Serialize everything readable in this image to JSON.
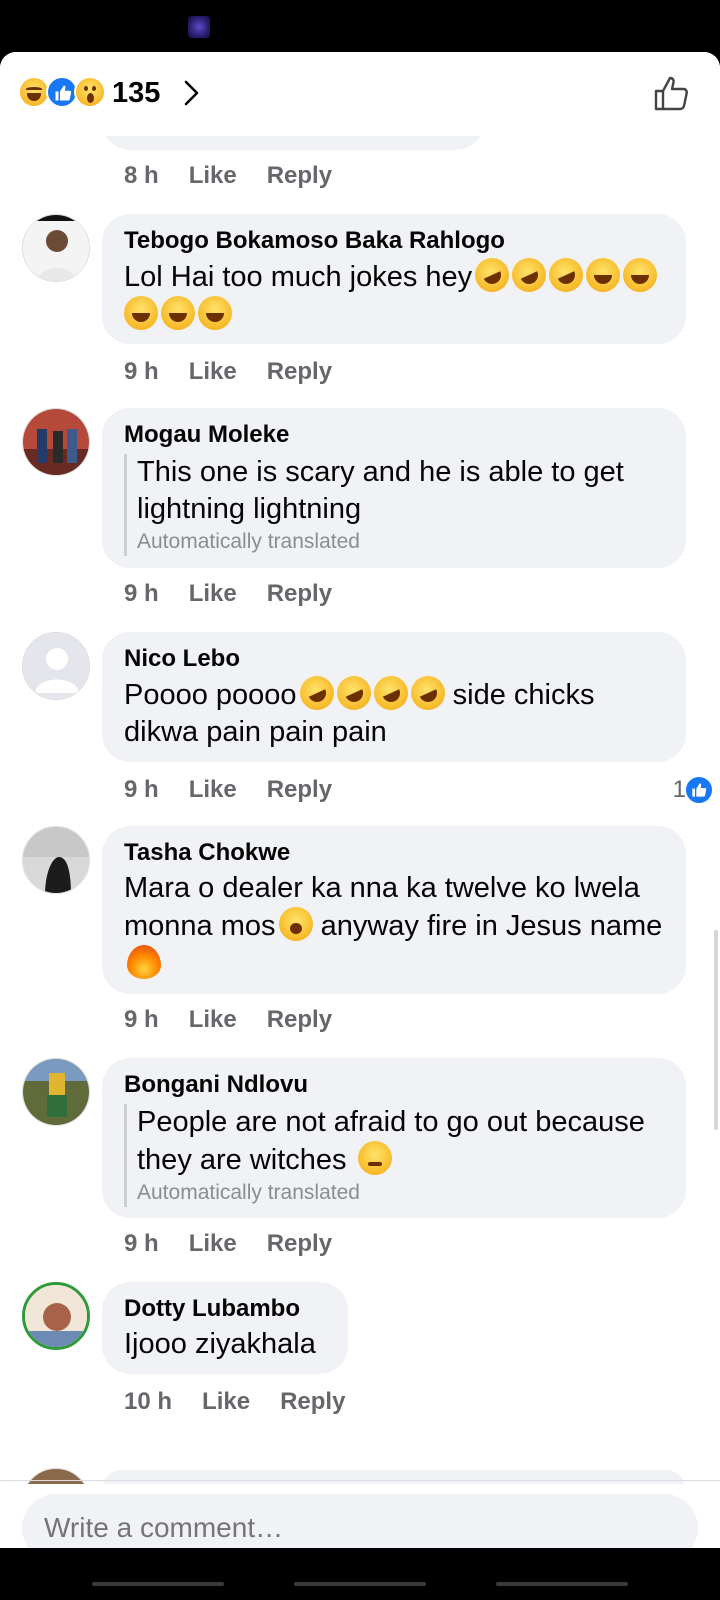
{
  "header": {
    "reaction_count": "135",
    "reaction_icons": [
      "haha-reaction-icon",
      "like-reaction-icon",
      "wow-reaction-icon"
    ],
    "actions": [
      "chevron-right-icon",
      "thumbs-up-icon"
    ]
  },
  "partial_comment": {
    "time": "8 h",
    "like_label": "Like",
    "reply_label": "Reply"
  },
  "comments": [
    {
      "author": "Tebogo Bokamoso Baka Rahlogo",
      "text": "Lol Hai too much jokes hey",
      "time": "9 h",
      "like_label": "Like",
      "reply_label": "Reply"
    },
    {
      "author": "Mogau Moleke",
      "text": "This one is scary and he is able to get lightning lightning",
      "translated_label": "Automatically translated",
      "time": "9 h",
      "like_label": "Like",
      "reply_label": "Reply"
    },
    {
      "author": "Nico Lebo",
      "text_before": "Poooo poooo",
      "text_after": " side chicks dikwa pain pain pain",
      "time": "9 h",
      "like_label": "Like",
      "reply_label": "Reply",
      "likes": "1"
    },
    {
      "author": "Tasha Chokwe",
      "text_before": "Mara o dealer ka nna ka twelve ko lwela monna mos",
      "text_middle": " anyway fire in Jesus name",
      "time": "9 h",
      "like_label": "Like",
      "reply_label": "Reply"
    },
    {
      "author": "Bongani Ndlovu",
      "text": "People are not afraid to go out because they are witches",
      "translated_label": "Automatically translated",
      "time": "9 h",
      "like_label": "Like",
      "reply_label": "Reply"
    },
    {
      "author": "Dotty Lubambo",
      "text": "Ijooo ziyakhala",
      "time": "10 h",
      "like_label": "Like",
      "reply_label": "Reply"
    }
  ],
  "composer": {
    "placeholder": "Write a comment…"
  },
  "colors": {
    "like_blue": "#1877f2",
    "bubble_bg": "#f0f2f5",
    "meta_gray": "#65676b"
  }
}
